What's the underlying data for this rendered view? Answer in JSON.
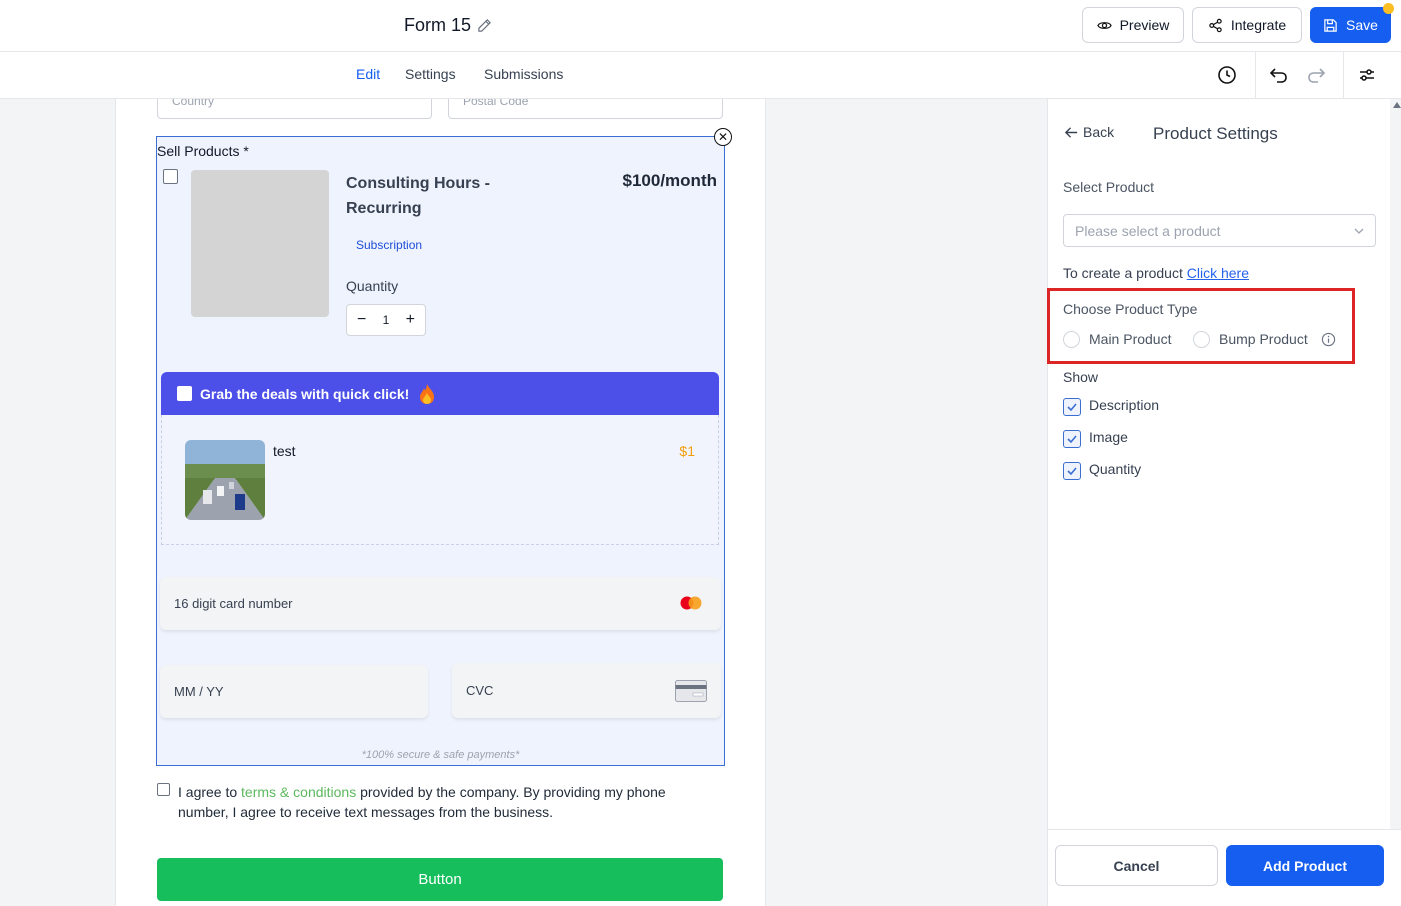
{
  "header": {
    "form_title": "Form 15",
    "preview_label": "Preview",
    "integrate_label": "Integrate",
    "save_label": "Save"
  },
  "tabs": [
    {
      "label": "Edit",
      "active": true
    },
    {
      "label": "Settings",
      "active": false
    },
    {
      "label": "Submissions",
      "active": false
    }
  ],
  "form": {
    "country_placeholder": "Country",
    "postal_placeholder": "Postal Code",
    "sell_label": "Sell Products *",
    "product": {
      "name": "Consulting Hours - Recurring",
      "price": "$100/month",
      "badge": "Subscription",
      "quantity_label": "Quantity",
      "quantity_value": "1"
    },
    "bump": {
      "header": "Grab the deals with quick click!",
      "header_icon": "fire-emoji",
      "name": "test",
      "price": "$1"
    },
    "card_number_placeholder": "16 digit card number",
    "expiry_placeholder": "MM / YY",
    "cvc_placeholder": "CVC",
    "secure_note": "*100% secure & safe payments*",
    "agree_prefix": "I agree to ",
    "agree_link": "terms & conditions",
    "agree_suffix": " provided by the company. By providing my phone number, I agree to receive text messages from the business.",
    "submit_label": "Button"
  },
  "panel": {
    "back_label": "Back",
    "title": "Product Settings",
    "select_label": "Select Product",
    "select_placeholder": "Please select a product",
    "create_text": "To create a product ",
    "create_link": "Click here",
    "type_label": "Choose Product Type",
    "type_options": [
      {
        "label": "Main Product",
        "selected": false
      },
      {
        "label": "Bump Product",
        "selected": false
      }
    ],
    "show_label": "Show",
    "show_options": [
      {
        "label": "Description",
        "checked": true
      },
      {
        "label": "Image",
        "checked": true
      },
      {
        "label": "Quantity",
        "checked": true
      }
    ],
    "cancel_label": "Cancel",
    "add_label": "Add Product"
  },
  "colors": {
    "primary": "#155eef",
    "bump_header": "#4d50e8",
    "submit": "#16be5c",
    "highlight": "#dc2626",
    "price_bump": "#f59e0b"
  }
}
